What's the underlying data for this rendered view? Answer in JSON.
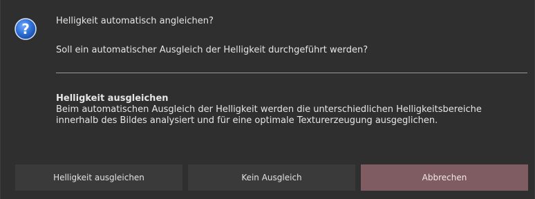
{
  "dialog": {
    "icon": "question-icon",
    "title": "Helligkeit automatisch angleichen?",
    "message": "Soll ein automatischer Ausgleich der Helligkeit durchgeführt werden?",
    "details": {
      "heading": "Helligkeit ausgleichen",
      "line1": "Beim automatischen Ausgleich der Helligkeit werden die unterschiedlichen Helligkeitsbereiche",
      "line2": "innerhalb des Bildes analysiert und für eine optimale Texturerzeugung ausgeglichen."
    },
    "buttons": {
      "equalize_label": "Helligkeit ausgleichen",
      "no_equalize_label": "Kein Ausgleich",
      "cancel_label": "Abbrechen"
    }
  },
  "colors": {
    "background": "#2f2f2f",
    "button": "#3a3a3a",
    "cancel_button": "#7e5c61",
    "icon_blue": "#1f5fbf"
  }
}
